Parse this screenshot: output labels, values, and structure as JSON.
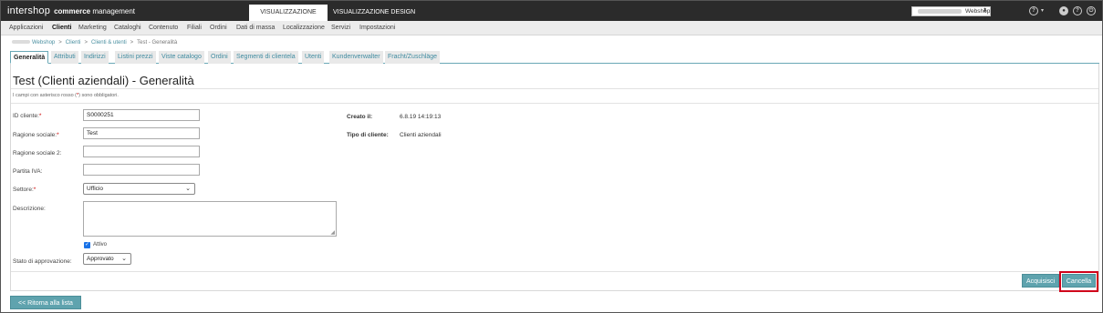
{
  "topbar": {
    "brand": "intershop",
    "product_bold": "commerce",
    "product_rest": " management",
    "view_tabs": [
      "VISUALIZZAZIONE DATI",
      "VISUALIZZAZIONE DESIGN"
    ],
    "site_select_value": "Webshop",
    "icons": [
      "help-dropdown-icon",
      "user-icon",
      "help-icon",
      "logout-icon"
    ]
  },
  "menu": [
    "Applicazioni",
    "Clienti",
    "Marketing",
    "Cataloghi",
    "Contenuto",
    "Filiali",
    "Ordini",
    "Dati di massa",
    "Localizzazione",
    "Servizi",
    "Impostazioni"
  ],
  "menu_active": "Clienti",
  "breadcrumb": {
    "items": [
      "Webshop",
      "Clienti",
      "Clienti & utenti",
      "Test - Generalità"
    ]
  },
  "tabs": [
    "Generalità",
    "Attributi",
    "Indirizzi",
    "Listini prezzi",
    "Viste catalogo",
    "Ordini",
    "Segmenti di clientela",
    "Utenti",
    "Kundenverwalter",
    "Fracht/Zuschläge"
  ],
  "page": {
    "title": "Test (Clienti aziendali) - Generalità",
    "required_note_pre": "I campi con asterisco rosso (",
    "required_note_star": "*",
    "required_note_post": ") sono obbligatori."
  },
  "form": {
    "id_label": "ID cliente:",
    "id_value": "S0000251",
    "name_label": "Ragione sociale:",
    "name_value": "Test",
    "name2_label": "Ragione sociale 2:",
    "name2_value": "",
    "vat_label": "Partita IVA:",
    "vat_value": "",
    "sector_label": "Settore:",
    "sector_value": "Ufficio",
    "description_label": "Descrizione:",
    "active_label": "Attivo",
    "active_checked": true,
    "approval_label": "Stato di approvazione:",
    "approval_value": "Approvato",
    "required_star": "*"
  },
  "info": {
    "created_label": "Creato il:",
    "created_value": "6.8.19 14:19:13",
    "type_label": "Tipo di cliente:",
    "type_value": "Clienti aziendali"
  },
  "buttons": {
    "apply": "Acquisisci",
    "cancel": "Cancella",
    "back": "<< Ritorna alla lista"
  },
  "colors": {
    "topbar": "#2b2b2b",
    "accent": "#5fa3ae",
    "link": "#3f8ba0",
    "highlight": "#d0021b"
  }
}
